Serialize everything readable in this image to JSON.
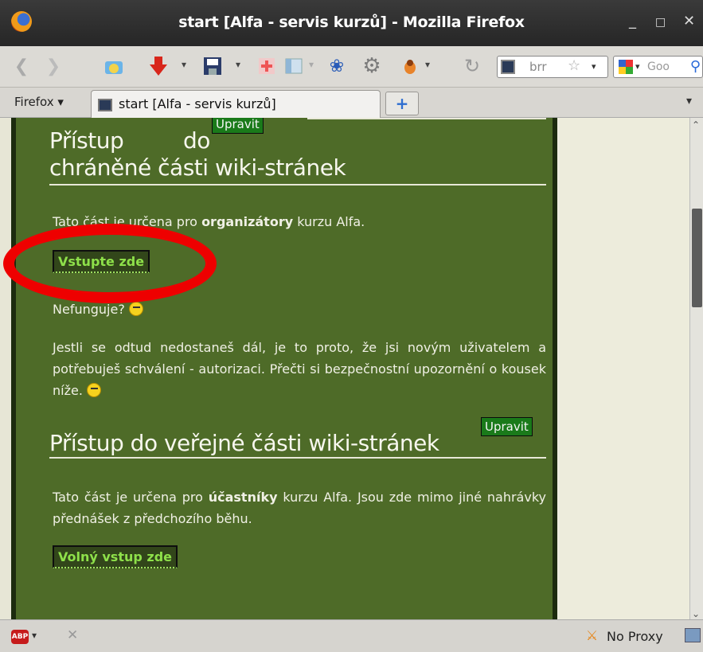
{
  "window": {
    "title": "start [Alfa - servis kurzů] - Mozilla Firefox",
    "min_label": "_",
    "max_label": "□",
    "close_label": "✕"
  },
  "toolbar": {
    "url_text": "brr",
    "search_text": "Goo"
  },
  "tabs": {
    "firefox_menu": "Firefox ▾",
    "active_tab": "start [Alfa - servis kurzů]",
    "new_tab_label": "+"
  },
  "content": {
    "section1": {
      "edit_label": "Upravit",
      "heading_line1_a": "Přístup",
      "heading_line1_b": "do",
      "heading_line2": "chráněné části wiki-stránek",
      "intro_prefix": "Tato část je určena pro",
      "intro_bold": "organizátory",
      "intro_suffix": "kurzu Alfa.",
      "enter_button": "Vstupte zde",
      "not_working": "Nefunguje?",
      "explain": "Jestli se odtud nedostaneš dál, je to proto, že jsi novým uživatelem a potřebuješ schválení - autorizaci. Přečti si bezpečnostní upozornění o kousek níže."
    },
    "section2": {
      "edit_label": "Upravit",
      "heading": "Přístup do veřejné části wiki-stránek",
      "intro_prefix": "Tato část je určena pro",
      "intro_bold": "účastníky",
      "intro_suffix": "kurzu Alfa. Jsou zde mimo jiné nahrávky přednášek z předchozího běhu.",
      "enter_button": "Volný vstup zde"
    }
  },
  "statusbar": {
    "abp": "ABP",
    "proxy": "No Proxy"
  },
  "colors": {
    "page_green": "#4e6b28",
    "annotation_red": "#ee0000",
    "link_green": "#8ee04a"
  }
}
